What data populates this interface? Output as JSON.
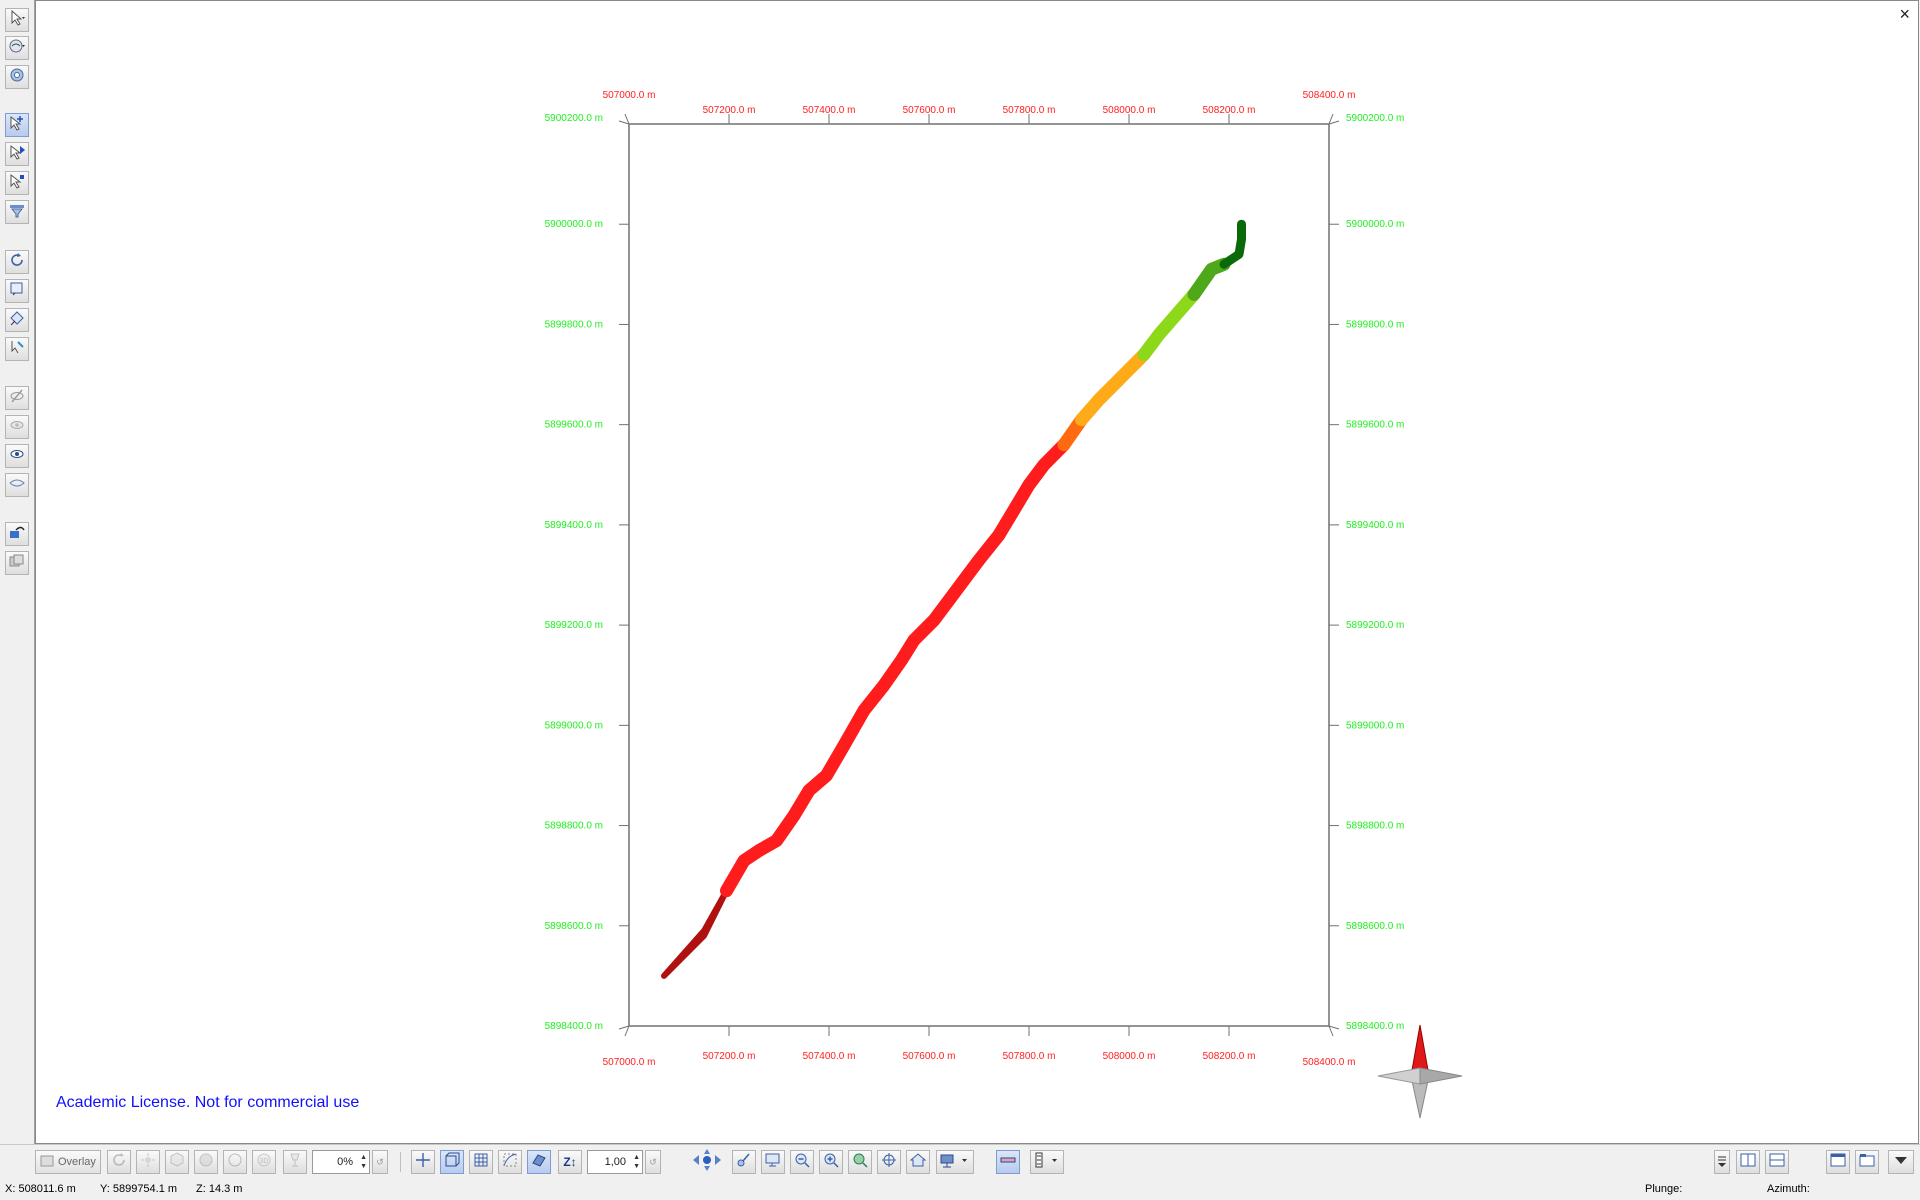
{
  "viewport": {
    "close_label": "×",
    "license_text": "Academic License. Not for commercial use",
    "colors": {
      "easting": "#ff2020",
      "northing": "#22ee22",
      "frame": "#707070"
    }
  },
  "map": {
    "x_ticks": [
      "507000.0 m",
      "507200.0 m",
      "507400.0 m",
      "507600.0 m",
      "507800.0 m",
      "508000.0 m",
      "508200.0 m",
      "508400.0 m"
    ],
    "y_ticks": [
      "5900200.0 m",
      "5900000.0 m",
      "5899800.0 m",
      "5899600.0 m",
      "5899400.0 m",
      "5899200.0 m",
      "5899000.0 m",
      "5898800.0 m",
      "5898600.0 m",
      "5898400.0 m"
    ],
    "x_range": [
      507000,
      508400
    ],
    "y_range": [
      5898400,
      5900200
    ],
    "body_segments": [
      {
        "color": "#b01010",
        "points": [
          [
            507070,
            5898500
          ],
          [
            507150,
            5898580
          ],
          [
            507195,
            5898670
          ],
          [
            507150,
            5898590
          ],
          [
            507070,
            5898500
          ]
        ]
      },
      {
        "color": "#ff1c1c",
        "points": [
          [
            507195,
            5898670
          ],
          [
            507230,
            5898730
          ],
          [
            507260,
            5898750
          ],
          [
            507295,
            5898770
          ],
          [
            507330,
            5898820
          ],
          [
            507360,
            5898870
          ],
          [
            507395,
            5898900
          ],
          [
            507430,
            5898960
          ],
          [
            507470,
            5899030
          ],
          [
            507510,
            5899080
          ],
          [
            507545,
            5899130
          ],
          [
            507570,
            5899170
          ],
          [
            507610,
            5899210
          ],
          [
            507640,
            5899250
          ],
          [
            507670,
            5899290
          ],
          [
            507700,
            5899330
          ],
          [
            507740,
            5899380
          ],
          [
            507770,
            5899430
          ],
          [
            507800,
            5899480
          ],
          [
            507830,
            5899520
          ],
          [
            507870,
            5899560
          ]
        ]
      },
      {
        "color": "#ff6a10",
        "points": [
          [
            507870,
            5899560
          ],
          [
            507905,
            5899610
          ]
        ]
      },
      {
        "color": "#ffaa18",
        "points": [
          [
            507905,
            5899610
          ],
          [
            507940,
            5899650
          ],
          [
            507980,
            5899690
          ],
          [
            508030,
            5899740
          ]
        ]
      },
      {
        "color": "#8ed81a",
        "points": [
          [
            508030,
            5899740
          ],
          [
            508060,
            5899780
          ],
          [
            508095,
            5899820
          ],
          [
            508130,
            5899860
          ]
        ]
      },
      {
        "color": "#4ea81a",
        "points": [
          [
            508130,
            5899860
          ],
          [
            508165,
            5899910
          ],
          [
            508190,
            5899920
          ]
        ]
      },
      {
        "color": "#0a6a0a",
        "points": [
          [
            508190,
            5899920
          ],
          [
            508220,
            5899940
          ],
          [
            508225,
            5899970
          ],
          [
            508225,
            5900000
          ]
        ]
      }
    ]
  },
  "left_toolbar": {
    "icons": [
      "select-icon",
      "view-mode-icon",
      "settings-icon",
      "pick-point-icon",
      "pick-vertex-icon",
      "pick-object-icon",
      "filter-icon",
      "rotate-icon",
      "zoom-box-icon",
      "measure-icon",
      "probe-icon",
      "hide-icon",
      "ghost-icon",
      "show-icon",
      "surface-icon",
      "edit-icon",
      "copy-icon"
    ]
  },
  "bottom_toolbar": {
    "overlay_label": "Overlay",
    "opacity_value": "0%",
    "exaggeration_value": "1,00",
    "z_label": "Z↕"
  },
  "status_bar": {
    "x_readout": "X:  508011.6 m",
    "y_readout": "Y:  5899754.1 m",
    "z_readout": "Z:  14.3 m",
    "plunge_label": "Plunge:",
    "azimuth_label": "Azimuth:"
  }
}
